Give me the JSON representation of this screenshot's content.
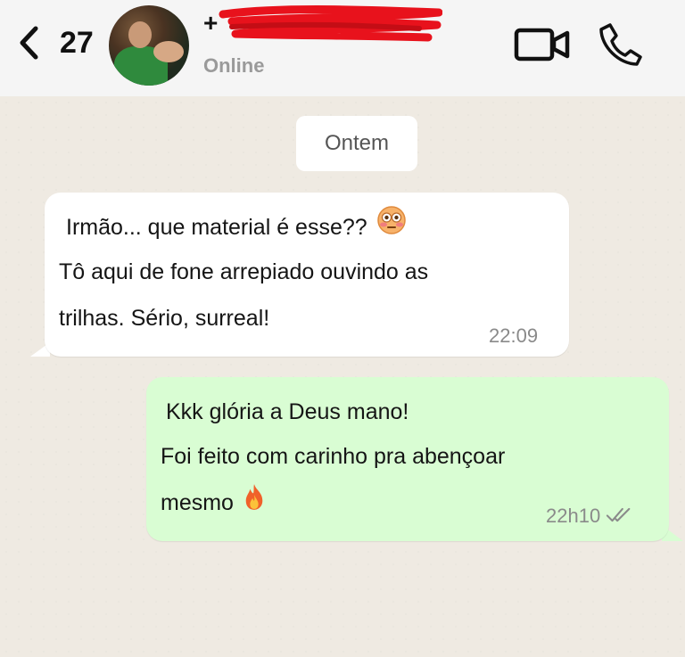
{
  "header": {
    "back_icon": "chevron-left-icon",
    "unread_count": "27",
    "contact_name": "+",
    "status": "Online",
    "video_icon": "video-camera-icon",
    "call_icon": "phone-icon"
  },
  "chat": {
    "date_separator": "Ontem",
    "messages": [
      {
        "direction": "incoming",
        "lines": [
          "Irmão... que material é esse??",
          "Tô aqui de fone arrepiado ouvindo as",
          "trilhas. Sério, surreal!"
        ],
        "emoji": "flushed-face-icon",
        "time": "22:09"
      },
      {
        "direction": "outgoing",
        "lines": [
          "Kkk glória a Deus mano!",
          "Foi feito com carinho pra abençoar",
          "mesmo"
        ],
        "emoji": "fire-icon",
        "time": "22h10",
        "read_icon": "double-check-icon"
      }
    ]
  },
  "colors": {
    "chat_background": "#efeae2",
    "header_background": "#f5f5f5",
    "incoming_bubble": "#ffffff",
    "outgoing_bubble": "#d9fdd3",
    "redaction": "#e8121c"
  }
}
